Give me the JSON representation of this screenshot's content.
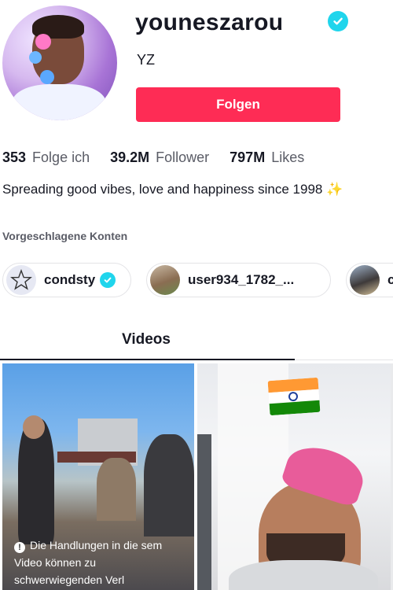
{
  "profile": {
    "username": "youneszarou",
    "nickname": "YZ",
    "follow_label": "Folgen",
    "stats": [
      {
        "value": "353",
        "label": "Folge ich"
      },
      {
        "value": "39.2M",
        "label": "Follower"
      },
      {
        "value": "797M",
        "label": "Likes"
      }
    ],
    "bio": "Spreading good vibes, love and happiness since 1998",
    "bio_emoji": "✨"
  },
  "suggested": {
    "title": "Vorgeschlagene Konten",
    "accounts": [
      {
        "name": "condsty",
        "verified": true
      },
      {
        "name": "user934_1782_...",
        "verified": false
      },
      {
        "name": "c",
        "verified": false
      }
    ]
  },
  "tabs": {
    "videos": "Videos"
  },
  "videos": {
    "warning": "Die Handlungen in die sem Video können zu schwerwiegenden Verl"
  },
  "colors": {
    "accent": "#fe2c55",
    "verified": "#20d5ec"
  },
  "icons": {
    "verified": "verified-badge-icon",
    "warning": "warning-icon",
    "sparkles": "sparkles-emoji"
  }
}
